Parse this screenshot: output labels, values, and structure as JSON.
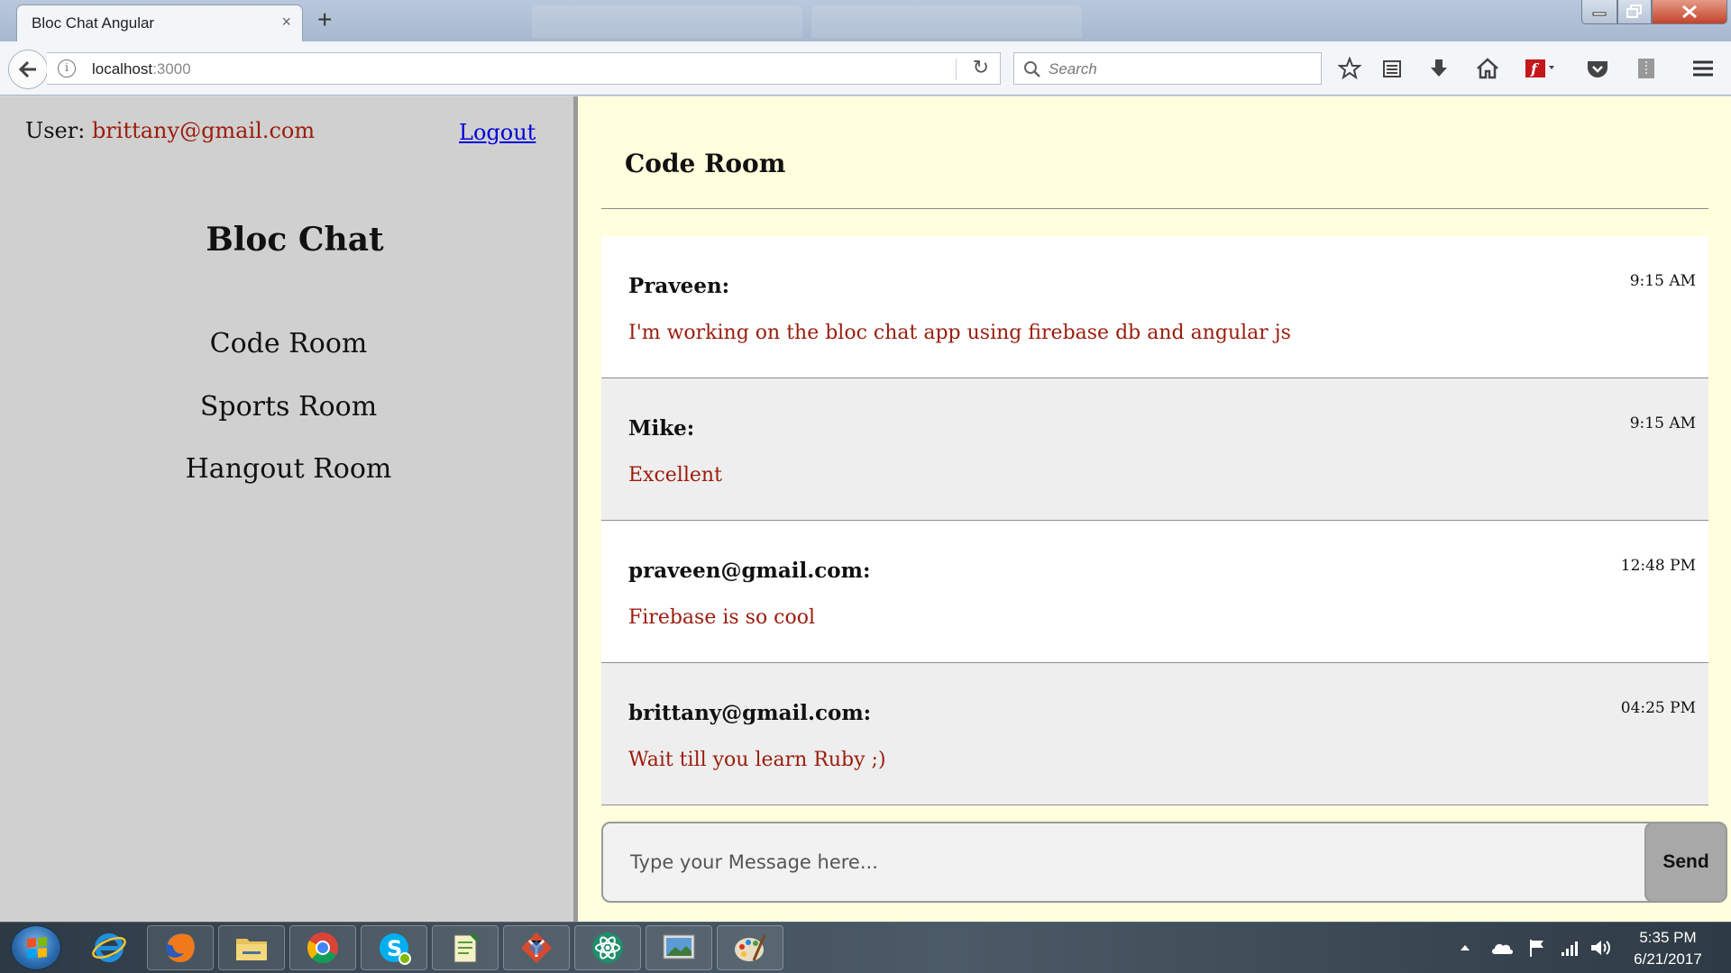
{
  "browser": {
    "tab_title": "Bloc Chat Angular",
    "tab_close": "×",
    "new_tab": "+",
    "url_host": "localhost",
    "url_port": ":3000",
    "search_placeholder": "Search",
    "icons": [
      "back-icon",
      "info-icon",
      "reload-icon",
      "search-icon",
      "bookmark-star-icon",
      "reading-list-icon",
      "download-icon",
      "home-icon",
      "flash-icon",
      "pocket-icon",
      "extension-icon",
      "menu-icon"
    ]
  },
  "app": {
    "user_label": "User: ",
    "user_email": "brittany@gmail.com",
    "logout": "Logout",
    "title": "Bloc Chat",
    "rooms": [
      "Code Room",
      "Sports Room",
      "Hangout Room"
    ],
    "active_room_title": "Code Room",
    "messages": [
      {
        "author": "Praveen:",
        "time": "9:15 AM",
        "text": "I'm working on the bloc chat app using firebase db and angular js"
      },
      {
        "author": "Mike:",
        "time": "9:15 AM",
        "text": "Excellent"
      },
      {
        "author": "praveen@gmail.com:",
        "time": "12:48 PM",
        "text": "Firebase is so cool"
      },
      {
        "author": "brittany@gmail.com:",
        "time": "04:25 PM",
        "text": "Wait till you learn Ruby ;)"
      }
    ],
    "message_placeholder": "Type your Message here...",
    "send": "Send",
    "colors": {
      "sidebar_bg": "#d0d0d0",
      "chat_bg": "#fffedd",
      "message_text": "#9b1c0c",
      "link": "#0000d8",
      "alt_row": "#eeeeee",
      "row": "#ffffff"
    }
  },
  "taskbar": {
    "apps": [
      "internet-explorer-icon",
      "firefox-icon",
      "file-explorer-icon",
      "chrome-icon",
      "skype-icon",
      "notepad-icon",
      "git-icon",
      "atom-icon",
      "photo-viewer-icon",
      "paint-icon"
    ],
    "tray": [
      "show-hidden-icons",
      "onedrive-icon",
      "action-center-flag-icon",
      "network-icon",
      "volume-icon"
    ],
    "time": "5:35 PM",
    "date": "6/21/2017"
  }
}
